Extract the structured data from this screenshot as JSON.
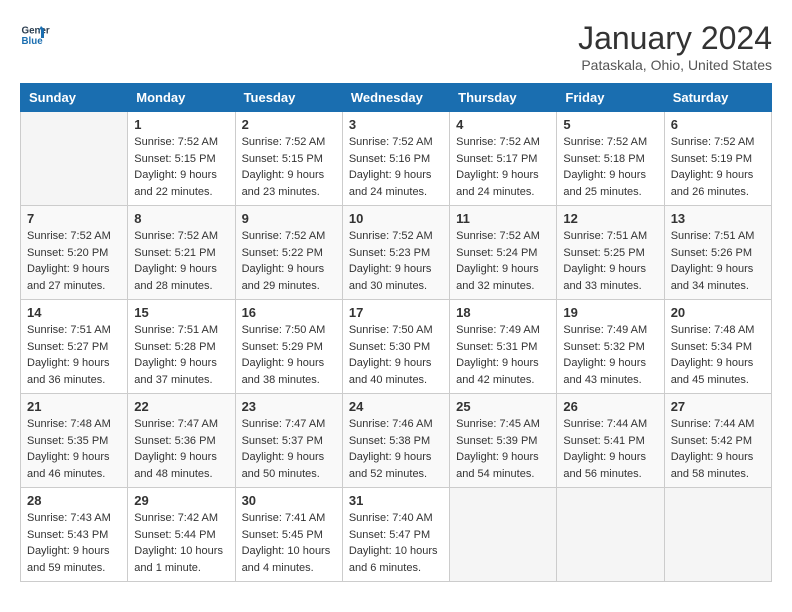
{
  "header": {
    "logo_line1": "General",
    "logo_line2": "Blue",
    "title": "January 2024",
    "subtitle": "Pataskala, Ohio, United States"
  },
  "weekdays": [
    "Sunday",
    "Monday",
    "Tuesday",
    "Wednesday",
    "Thursday",
    "Friday",
    "Saturday"
  ],
  "weeks": [
    [
      {
        "day": "",
        "empty": true
      },
      {
        "day": "1",
        "sunrise": "Sunrise: 7:52 AM",
        "sunset": "Sunset: 5:15 PM",
        "daylight": "Daylight: 9 hours and 22 minutes."
      },
      {
        "day": "2",
        "sunrise": "Sunrise: 7:52 AM",
        "sunset": "Sunset: 5:15 PM",
        "daylight": "Daylight: 9 hours and 23 minutes."
      },
      {
        "day": "3",
        "sunrise": "Sunrise: 7:52 AM",
        "sunset": "Sunset: 5:16 PM",
        "daylight": "Daylight: 9 hours and 24 minutes."
      },
      {
        "day": "4",
        "sunrise": "Sunrise: 7:52 AM",
        "sunset": "Sunset: 5:17 PM",
        "daylight": "Daylight: 9 hours and 24 minutes."
      },
      {
        "day": "5",
        "sunrise": "Sunrise: 7:52 AM",
        "sunset": "Sunset: 5:18 PM",
        "daylight": "Daylight: 9 hours and 25 minutes."
      },
      {
        "day": "6",
        "sunrise": "Sunrise: 7:52 AM",
        "sunset": "Sunset: 5:19 PM",
        "daylight": "Daylight: 9 hours and 26 minutes."
      }
    ],
    [
      {
        "day": "7",
        "sunrise": "Sunrise: 7:52 AM",
        "sunset": "Sunset: 5:20 PM",
        "daylight": "Daylight: 9 hours and 27 minutes."
      },
      {
        "day": "8",
        "sunrise": "Sunrise: 7:52 AM",
        "sunset": "Sunset: 5:21 PM",
        "daylight": "Daylight: 9 hours and 28 minutes."
      },
      {
        "day": "9",
        "sunrise": "Sunrise: 7:52 AM",
        "sunset": "Sunset: 5:22 PM",
        "daylight": "Daylight: 9 hours and 29 minutes."
      },
      {
        "day": "10",
        "sunrise": "Sunrise: 7:52 AM",
        "sunset": "Sunset: 5:23 PM",
        "daylight": "Daylight: 9 hours and 30 minutes."
      },
      {
        "day": "11",
        "sunrise": "Sunrise: 7:52 AM",
        "sunset": "Sunset: 5:24 PM",
        "daylight": "Daylight: 9 hours and 32 minutes."
      },
      {
        "day": "12",
        "sunrise": "Sunrise: 7:51 AM",
        "sunset": "Sunset: 5:25 PM",
        "daylight": "Daylight: 9 hours and 33 minutes."
      },
      {
        "day": "13",
        "sunrise": "Sunrise: 7:51 AM",
        "sunset": "Sunset: 5:26 PM",
        "daylight": "Daylight: 9 hours and 34 minutes."
      }
    ],
    [
      {
        "day": "14",
        "sunrise": "Sunrise: 7:51 AM",
        "sunset": "Sunset: 5:27 PM",
        "daylight": "Daylight: 9 hours and 36 minutes."
      },
      {
        "day": "15",
        "sunrise": "Sunrise: 7:51 AM",
        "sunset": "Sunset: 5:28 PM",
        "daylight": "Daylight: 9 hours and 37 minutes."
      },
      {
        "day": "16",
        "sunrise": "Sunrise: 7:50 AM",
        "sunset": "Sunset: 5:29 PM",
        "daylight": "Daylight: 9 hours and 38 minutes."
      },
      {
        "day": "17",
        "sunrise": "Sunrise: 7:50 AM",
        "sunset": "Sunset: 5:30 PM",
        "daylight": "Daylight: 9 hours and 40 minutes."
      },
      {
        "day": "18",
        "sunrise": "Sunrise: 7:49 AM",
        "sunset": "Sunset: 5:31 PM",
        "daylight": "Daylight: 9 hours and 42 minutes."
      },
      {
        "day": "19",
        "sunrise": "Sunrise: 7:49 AM",
        "sunset": "Sunset: 5:32 PM",
        "daylight": "Daylight: 9 hours and 43 minutes."
      },
      {
        "day": "20",
        "sunrise": "Sunrise: 7:48 AM",
        "sunset": "Sunset: 5:34 PM",
        "daylight": "Daylight: 9 hours and 45 minutes."
      }
    ],
    [
      {
        "day": "21",
        "sunrise": "Sunrise: 7:48 AM",
        "sunset": "Sunset: 5:35 PM",
        "daylight": "Daylight: 9 hours and 46 minutes."
      },
      {
        "day": "22",
        "sunrise": "Sunrise: 7:47 AM",
        "sunset": "Sunset: 5:36 PM",
        "daylight": "Daylight: 9 hours and 48 minutes."
      },
      {
        "day": "23",
        "sunrise": "Sunrise: 7:47 AM",
        "sunset": "Sunset: 5:37 PM",
        "daylight": "Daylight: 9 hours and 50 minutes."
      },
      {
        "day": "24",
        "sunrise": "Sunrise: 7:46 AM",
        "sunset": "Sunset: 5:38 PM",
        "daylight": "Daylight: 9 hours and 52 minutes."
      },
      {
        "day": "25",
        "sunrise": "Sunrise: 7:45 AM",
        "sunset": "Sunset: 5:39 PM",
        "daylight": "Daylight: 9 hours and 54 minutes."
      },
      {
        "day": "26",
        "sunrise": "Sunrise: 7:44 AM",
        "sunset": "Sunset: 5:41 PM",
        "daylight": "Daylight: 9 hours and 56 minutes."
      },
      {
        "day": "27",
        "sunrise": "Sunrise: 7:44 AM",
        "sunset": "Sunset: 5:42 PM",
        "daylight": "Daylight: 9 hours and 58 minutes."
      }
    ],
    [
      {
        "day": "28",
        "sunrise": "Sunrise: 7:43 AM",
        "sunset": "Sunset: 5:43 PM",
        "daylight": "Daylight: 9 hours and 59 minutes."
      },
      {
        "day": "29",
        "sunrise": "Sunrise: 7:42 AM",
        "sunset": "Sunset: 5:44 PM",
        "daylight": "Daylight: 10 hours and 1 minute."
      },
      {
        "day": "30",
        "sunrise": "Sunrise: 7:41 AM",
        "sunset": "Sunset: 5:45 PM",
        "daylight": "Daylight: 10 hours and 4 minutes."
      },
      {
        "day": "31",
        "sunrise": "Sunrise: 7:40 AM",
        "sunset": "Sunset: 5:47 PM",
        "daylight": "Daylight: 10 hours and 6 minutes."
      },
      {
        "day": "",
        "empty": true
      },
      {
        "day": "",
        "empty": true
      },
      {
        "day": "",
        "empty": true
      }
    ]
  ]
}
